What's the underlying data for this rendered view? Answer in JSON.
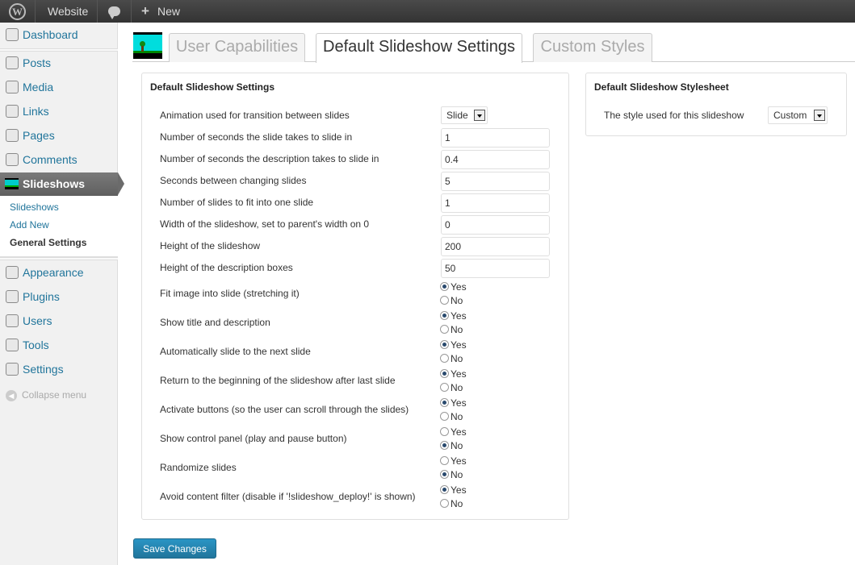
{
  "adminbar": {
    "site_label": "Website",
    "new_label": "New"
  },
  "sidebar": {
    "items": [
      {
        "label": "Dashboard",
        "icon": "dashboard-icon"
      },
      {
        "label": "Posts",
        "icon": "pin-icon"
      },
      {
        "label": "Media",
        "icon": "media-icon"
      },
      {
        "label": "Links",
        "icon": "link-icon"
      },
      {
        "label": "Pages",
        "icon": "pages-icon"
      },
      {
        "label": "Comments",
        "icon": "comments-icon"
      },
      {
        "label": "Slideshows",
        "icon": "slideshow-icon"
      },
      {
        "label": "Appearance",
        "icon": "appearance-icon"
      },
      {
        "label": "Plugins",
        "icon": "plugins-icon"
      },
      {
        "label": "Users",
        "icon": "users-icon"
      },
      {
        "label": "Tools",
        "icon": "tools-icon"
      },
      {
        "label": "Settings",
        "icon": "settings-icon"
      }
    ],
    "submenu": [
      "Slideshows",
      "Add New",
      "General Settings"
    ],
    "collapse_label": "Collapse menu"
  },
  "tabs": [
    {
      "label": "User Capabilities",
      "active": false
    },
    {
      "label": "Default Slideshow Settings",
      "active": true
    },
    {
      "label": "Custom Styles",
      "active": false
    }
  ],
  "settings_box": {
    "title": "Default Slideshow Settings",
    "animation": {
      "label": "Animation used for transition between slides",
      "value": "Slide"
    },
    "inputs": [
      {
        "label": "Number of seconds the slide takes to slide in",
        "value": "1"
      },
      {
        "label": "Number of seconds the description takes to slide in",
        "value": "0.4"
      },
      {
        "label": "Seconds between changing slides",
        "value": "5"
      },
      {
        "label": "Number of slides to fit into one slide",
        "value": "1"
      },
      {
        "label": "Width of the slideshow, set to parent's width on 0",
        "value": "0"
      },
      {
        "label": "Height of the slideshow",
        "value": "200"
      },
      {
        "label": "Height of the description boxes",
        "value": "50"
      }
    ],
    "radios": [
      {
        "label": "Fit image into slide (stretching it)",
        "value": "Yes"
      },
      {
        "label": "Show title and description",
        "value": "Yes"
      },
      {
        "label": "Automatically slide to the next slide",
        "value": "Yes"
      },
      {
        "label": "Return to the beginning of the slideshow after last slide",
        "value": "Yes"
      },
      {
        "label": "Activate buttons (so the user can scroll through the slides)",
        "value": "Yes"
      },
      {
        "label": "Show control panel (play and pause button)",
        "value": "No"
      },
      {
        "label": "Randomize slides",
        "value": "No"
      },
      {
        "label": "Avoid content filter (disable if '!slideshow_deploy!' is shown)",
        "value": "Yes"
      }
    ],
    "yes_label": "Yes",
    "no_label": "No"
  },
  "stylesheet_box": {
    "title": "Default Slideshow Stylesheet",
    "label": "The style used for this slideshow",
    "value": "Custom"
  },
  "save_label": "Save Changes",
  "colors": {
    "link": "#21759b",
    "active_menu": "#6b6b6b",
    "button": "#21759b"
  }
}
